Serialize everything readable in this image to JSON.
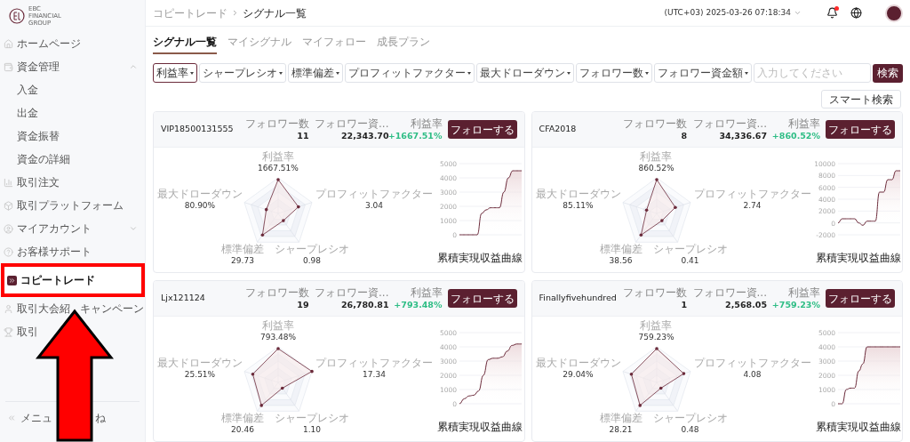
{
  "sidebar": {
    "logo": {
      "lines": [
        "EBC",
        "FINANCIAL",
        "GROUP"
      ]
    },
    "items": [
      {
        "label": "ホームページ",
        "kind": "main",
        "selected": false
      },
      {
        "label": "資金管理",
        "kind": "main",
        "selected": false,
        "expanded": true
      },
      {
        "label": "入金",
        "kind": "sub",
        "selected": false
      },
      {
        "label": "出金",
        "kind": "sub",
        "selected": false
      },
      {
        "label": "資金振替",
        "kind": "sub",
        "selected": false
      },
      {
        "label": "資金の詳細",
        "kind": "sub",
        "selected": false
      },
      {
        "label": "取引注文",
        "kind": "main",
        "selected": false
      },
      {
        "label": "取引プラットフォーム",
        "kind": "main",
        "selected": false
      },
      {
        "label": "マイアカウント",
        "kind": "main",
        "selected": false,
        "expanded": false
      },
      {
        "label": "お客様サポート",
        "kind": "main",
        "selected": false
      },
      {
        "label": "コピートレード",
        "kind": "main",
        "selected": true
      },
      {
        "label": "取引大会紹",
        "label_after": "キャンペーン",
        "kind": "main",
        "selected": false
      },
      {
        "label": "取引",
        "kind": "main",
        "selected": false
      }
    ],
    "collapse": {
      "label": "メニュ",
      "label_after": "ね"
    }
  },
  "header": {
    "breadcrumb": [
      "コピートレード",
      "シグナル一覧"
    ],
    "timezone": "(UTC+03)",
    "datetime": "2025-03-26 07:18:34",
    "notification_unread": true
  },
  "tabs": [
    {
      "label": "シグナル一覧",
      "selected": true
    },
    {
      "label": "マイシグナル",
      "selected": false
    },
    {
      "label": "マイフォロー",
      "selected": false
    },
    {
      "label": "成長プラン",
      "selected": false
    }
  ],
  "filters": [
    {
      "label": "利益率",
      "selected": true
    },
    {
      "label": "シャープレシオ",
      "selected": false
    },
    {
      "label": "標準偏差",
      "selected": false
    },
    {
      "label": "プロフィットファクター",
      "selected": false
    },
    {
      "label": "最大ドローダウン",
      "selected": false
    },
    {
      "label": "フォロワー数",
      "selected": false
    },
    {
      "label": "フォロワー資金額",
      "selected": false
    }
  ],
  "search": {
    "placeholder": "入力してください",
    "button": "検索"
  },
  "smart_search": "スマート検索",
  "cards": [
    {
      "name": "VIP18500131555",
      "stats": [
        {
          "label": "フォロワー数",
          "value": "11"
        },
        {
          "label": "フォロワー資...",
          "value": "22,343.70"
        },
        {
          "label": "利益率",
          "value": "+1667.51%"
        }
      ],
      "button": "フォローする",
      "radar": [
        {
          "label": "利益率",
          "value": "1667.51%"
        },
        {
          "label": "最大ドローダウン",
          "value": "80.90%"
        },
        {
          "label": "プロフィットファクター",
          "value": "3.04"
        },
        {
          "label": "標準偏差",
          "value": "29.73"
        },
        {
          "label": "シャープレシオ",
          "value": "0.98"
        }
      ],
      "chart_data": {
        "type": "line",
        "title": "累積実現収益曲線",
        "grid": true,
        "ylim": [
          0,
          5000
        ],
        "yticks": [
          0,
          1000,
          2000,
          3000,
          4000,
          5000
        ],
        "series": [
          {
            "color": "#6b2a3a",
            "values": [
              0,
              0,
              0,
              0,
              0,
              1500,
              1750,
              1900,
              1900,
              1900,
              3000,
              4000,
              4500,
              4500,
              4500
            ]
          }
        ]
      }
    },
    {
      "name": "CFA2018",
      "stats": [
        {
          "label": "フォロワー数",
          "value": "8"
        },
        {
          "label": "フォロワー資...",
          "value": "34,336.67"
        },
        {
          "label": "利益率",
          "value": "+860.52%"
        }
      ],
      "button": "フォローする",
      "radar": [
        {
          "label": "利益率",
          "value": "860.52%"
        },
        {
          "label": "最大ドローダウン",
          "value": "85.11%"
        },
        {
          "label": "プロフィットファクター",
          "value": "2.74"
        },
        {
          "label": "標準偏差",
          "value": "38.56"
        },
        {
          "label": "シャープレシオ",
          "value": "0.41"
        }
      ],
      "chart_data": {
        "type": "line",
        "title": "累積実現収益曲線",
        "grid": true,
        "ylim": [
          -2000,
          10000
        ],
        "yticks": [
          -2000,
          0,
          2000,
          4000,
          6000,
          8000,
          10000
        ],
        "series": [
          {
            "color": "#6b2a3a",
            "values": [
              0,
              700,
              700,
              700,
              700,
              0,
              -400,
              300,
              300,
              300,
              5200,
              5200,
              7300,
              7300,
              8800,
              8800
            ]
          }
        ]
      }
    },
    {
      "name": "Ljx121124",
      "stats": [
        {
          "label": "フォロワー数",
          "value": "19"
        },
        {
          "label": "フォロワー資...",
          "value": "26,780.81"
        },
        {
          "label": "利益率",
          "value": "+793.48%"
        }
      ],
      "button": "フォローする",
      "radar": [
        {
          "label": "利益率",
          "value": "793.48%"
        },
        {
          "label": "最大ドローダウン",
          "value": "25.51%"
        },
        {
          "label": "プロフィットファクター",
          "value": "17.34"
        },
        {
          "label": "標準偏差",
          "value": "20.46"
        },
        {
          "label": "シャープレシオ",
          "value": "1.10"
        }
      ],
      "chart_data": {
        "type": "line",
        "title": "累積実現収益曲線",
        "grid": true,
        "ylim": [
          0,
          5000
        ],
        "yticks": [
          0,
          1000,
          2000,
          3000,
          4000,
          5000
        ],
        "series": [
          {
            "color": "#6b2a3a",
            "values": [
              0,
              350,
              550,
              600,
              900,
              2000,
              3100,
              3200,
              3200,
              3300,
              3700,
              4100,
              4200,
              4200
            ]
          }
        ]
      }
    },
    {
      "name": "Finallyfivehundred",
      "stats": [
        {
          "label": "フォロワー数",
          "value": "1"
        },
        {
          "label": "フォロワー資...",
          "value": "2,568.05"
        },
        {
          "label": "利益率",
          "value": "+759.23%"
        }
      ],
      "button": "フォローする",
      "radar": [
        {
          "label": "利益率",
          "value": "759.23%"
        },
        {
          "label": "最大ドローダウン",
          "value": "29.04%"
        },
        {
          "label": "プロフィットファクター",
          "value": "4.08"
        },
        {
          "label": "標準偏差",
          "value": "28.21"
        },
        {
          "label": "シャープレシオ",
          "value": "0.48"
        }
      ],
      "chart_data": {
        "type": "line",
        "title": "累積実現収益曲線",
        "grid": true,
        "ylim": [
          0,
          5000
        ],
        "yticks": [
          0,
          1000,
          2000,
          3000,
          4000,
          5000
        ],
        "series": [
          {
            "color": "#6b2a3a",
            "values": [
              0,
              0,
              1000,
              1100,
              1100,
              2300,
              2800,
              4000,
              4000,
              4000,
              4000,
              4000,
              4000,
              4000,
              4000,
              4000
            ]
          }
        ]
      }
    }
  ]
}
